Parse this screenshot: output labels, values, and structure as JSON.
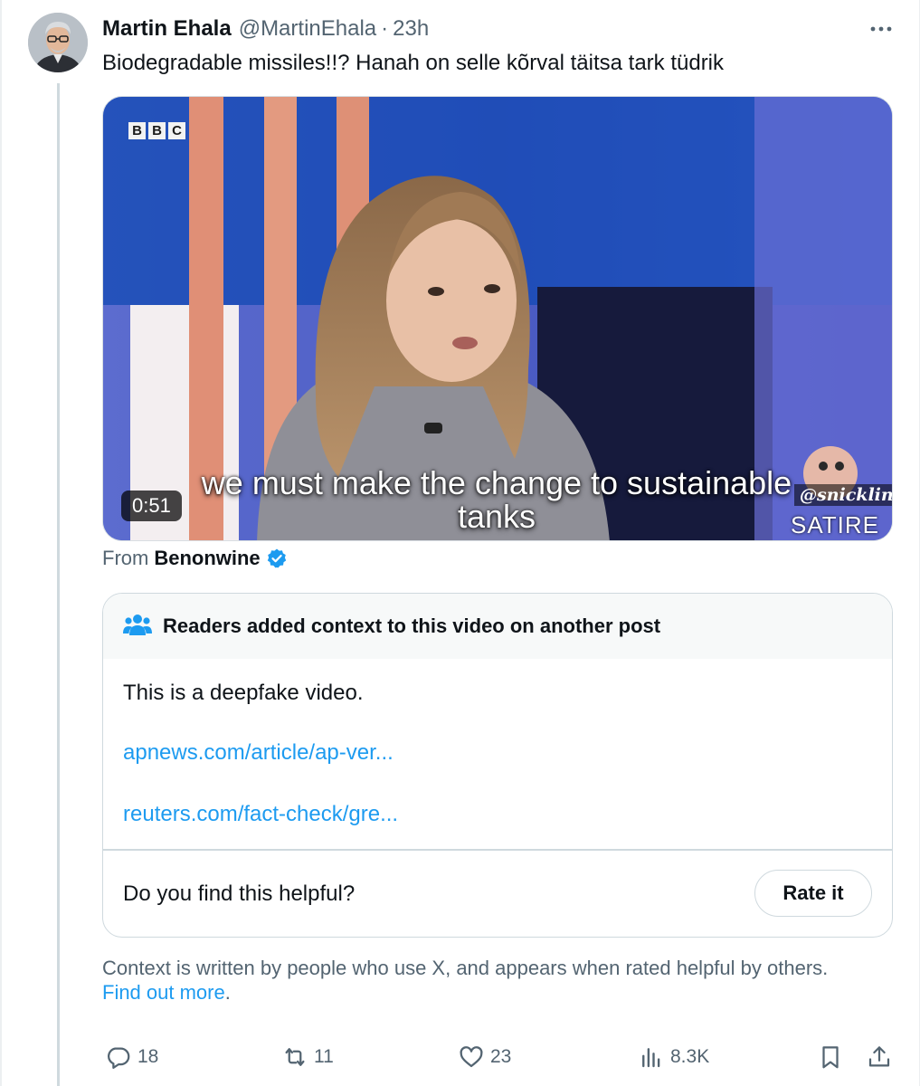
{
  "post": {
    "display_name": "Martin Ehala",
    "handle": "@MartinEhala",
    "separator": "·",
    "time": "23h",
    "more_icon": "more-horizontal-icon",
    "text": "Biodegradable missiles!!? Hanah on selle kõrval täitsa tark tüdrik"
  },
  "video": {
    "broadcaster_letters": [
      "B",
      "B",
      "C"
    ],
    "caption_line1": "we must make the change to sustainable",
    "caption_line2": "tanks",
    "duration": "0:51",
    "watermark_handle": "@snicklink",
    "watermark_label": "SATIRE"
  },
  "attribution": {
    "from_label": "From",
    "source": "Benonwine",
    "verified_icon": "verified-badge-icon"
  },
  "community_note": {
    "header": "Readers added context to this video on another post",
    "header_icon": "people-icon",
    "text": "This is a deepfake video.",
    "links": [
      "apnews.com/article/ap-ver...",
      "reuters.com/fact-check/gre..."
    ],
    "helpful_question": "Do you find this helpful?",
    "rate_button": "Rate it"
  },
  "disclaimer": {
    "text": "Context is written by people who use X, and appears when rated helpful by others.",
    "link": "Find out more",
    "suffix": "."
  },
  "actions": {
    "replies": "18",
    "reposts": "11",
    "likes": "23",
    "views": "8.3K"
  },
  "colors": {
    "accent": "#1d9bf0",
    "secondary_text": "#536471",
    "primary_text": "#0f1419",
    "border": "#cfd9de"
  }
}
